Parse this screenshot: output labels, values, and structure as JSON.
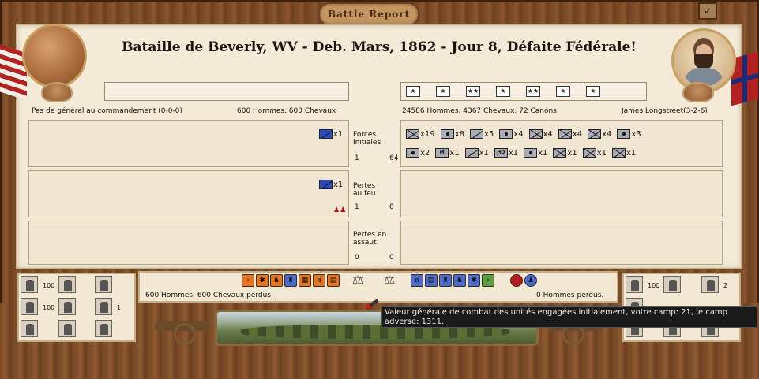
{
  "window": {
    "logo_text": "Battle Report",
    "title": "Bataille de Beverly, WV - Deb. Mars, 1862 - Jour 8, Défaite Fédérale!"
  },
  "union": {
    "commander": "Pas de général au commandement (0-0-0)",
    "strength": "600 Hommes, 600 Chevaux",
    "initial_forces": [
      {
        "icon": "cavalry-icon",
        "count": "x1"
      }
    ],
    "fire_losses": [
      {
        "icon": "cavalry-icon",
        "count": "x1"
      }
    ],
    "losses_summary": "600 Hommes, 600 Chevaux perdus.",
    "side_stats": [
      {
        "icon": "infantry-icon",
        "value": "100"
      },
      {
        "icon": "artillery-icon",
        "value": "100"
      },
      {
        "icon": "soldier-icon",
        "value": "1"
      }
    ],
    "color": "#2a4cc0"
  },
  "confederate": {
    "commander": "James Longstreet(3-2-6)",
    "strength": "24586 Hommes, 4367 Chevaux, 72 Canons",
    "rank_stars": [
      "★",
      "★",
      "★★",
      "★",
      "★★",
      "★",
      "★"
    ],
    "initial_forces_row1": [
      {
        "icon": "infantry-icon",
        "count": "x19"
      },
      {
        "icon": "engineer-icon",
        "count": "x8"
      },
      {
        "icon": "cavalry-icon",
        "count": "x5"
      },
      {
        "icon": "artillery-icon",
        "count": "x4"
      },
      {
        "icon": "artillery-icon",
        "count": "x4"
      },
      {
        "icon": "infantry-icon",
        "count": "x4"
      },
      {
        "icon": "infantry-icon",
        "count": "x4"
      },
      {
        "icon": "artillery-icon",
        "count": "x3"
      }
    ],
    "initial_forces_row2": [
      {
        "icon": "artillery-icon",
        "count": "x2"
      },
      {
        "icon": "militia-icon",
        "count": "x1"
      },
      {
        "icon": "cavalry-icon",
        "count": "x1"
      },
      {
        "icon": "hq-icon",
        "count": "x1"
      },
      {
        "icon": "artillery-icon",
        "count": "x1"
      },
      {
        "icon": "infantry-icon",
        "count": "x1"
      },
      {
        "icon": "infantry-icon",
        "count": "x1"
      },
      {
        "icon": "infantry-icon",
        "count": "x1"
      }
    ],
    "losses_summary": "0 Hommes perdus.",
    "side_stats": [
      {
        "icon": "infantry-icon",
        "value": "100"
      },
      {
        "icon": "soldier-icon",
        "value": "2"
      }
    ]
  },
  "rows": {
    "initial": {
      "label": "Forces Initiales",
      "left_val": "1",
      "right_val": "64"
    },
    "fire": {
      "label": "Pertes au feu",
      "left_val": "1",
      "right_val": "0"
    },
    "assault": {
      "label": "Pertes en assaut",
      "left_val": "0",
      "right_val": "0"
    }
  },
  "tooltip": "Valeur générale de combat des unités engagées initialement, votre camp: 21, le camp adverse: 1311."
}
